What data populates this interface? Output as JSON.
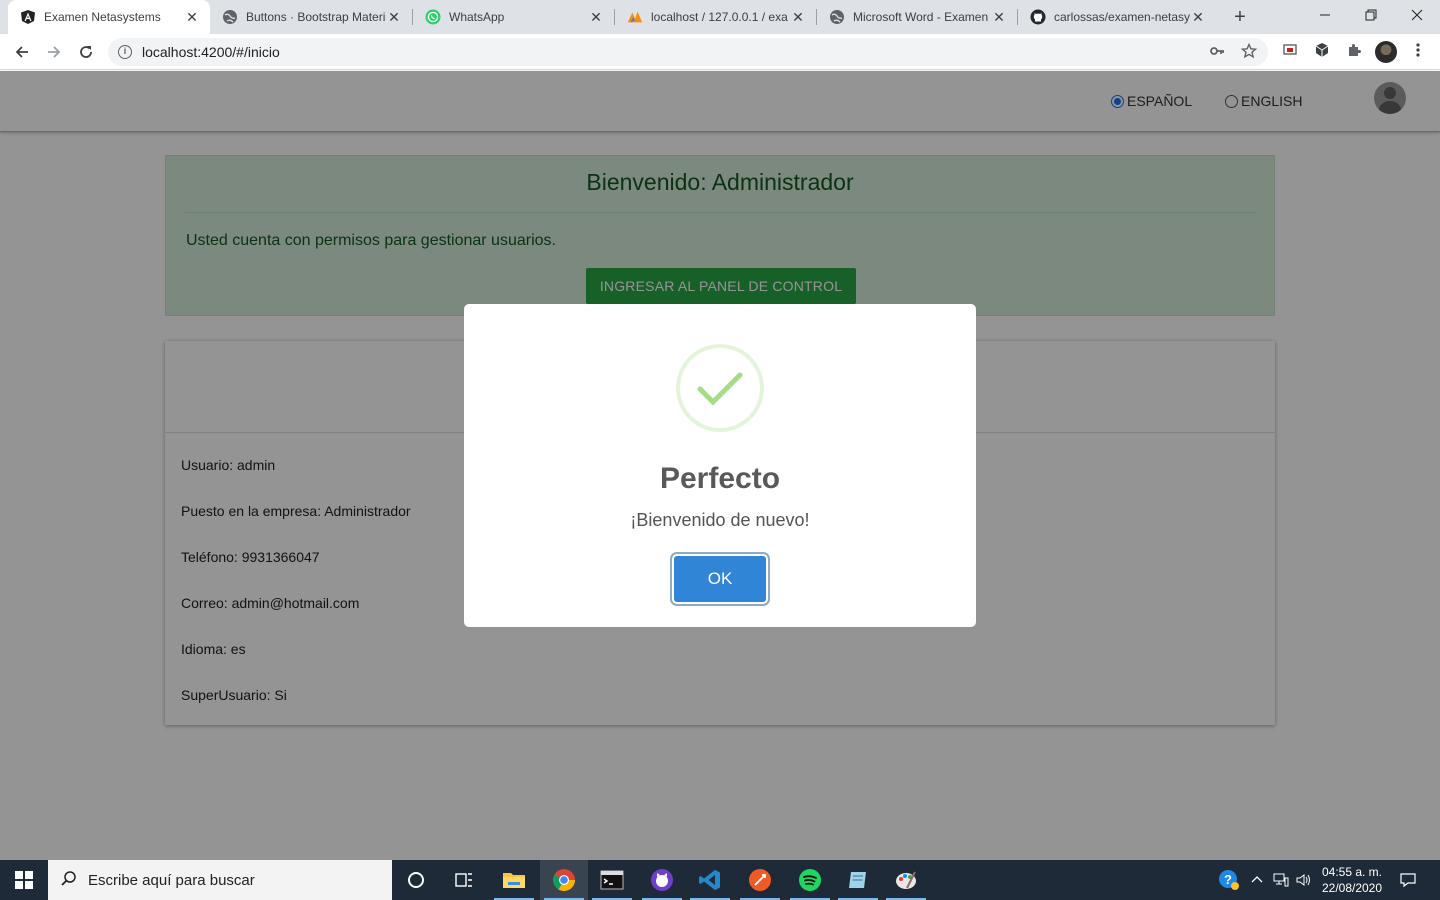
{
  "browser": {
    "tabs": [
      {
        "title": "Examen Netasystems",
        "icon": "angular-icon",
        "active": true
      },
      {
        "title": "Buttons · Bootstrap Material",
        "icon": "globe-icon",
        "active": false
      },
      {
        "title": "WhatsApp",
        "icon": "whatsapp-icon",
        "active": false
      },
      {
        "title": "localhost / 127.0.0.1 / exa",
        "icon": "phpmyadmin-icon",
        "active": false
      },
      {
        "title": "Microsoft Word - Examen",
        "icon": "globe-icon",
        "active": false
      },
      {
        "title": "carlossas/examen-netasys",
        "icon": "github-icon",
        "active": false
      }
    ],
    "url": "localhost:4200/#/inicio"
  },
  "app": {
    "languages": [
      {
        "label": "ESPAÑOL",
        "checked": true
      },
      {
        "label": "ENGLISH",
        "checked": false
      }
    ],
    "welcome": {
      "title": "Bienvenido: Administrador",
      "message": "Usted cuenta con permisos para gestionar usuarios.",
      "button": "INGRESAR AL PANEL DE CONTROL"
    },
    "profile": {
      "fields": [
        "Usuario: admin",
        "Puesto en la empresa: Administrador",
        "Teléfono: 9931366047",
        "Correo: admin@hotmail.com",
        "Idioma: es",
        "SuperUsuario: Si"
      ]
    }
  },
  "modal": {
    "icon": "success-check-icon",
    "title": "Perfecto",
    "message": "¡Bienvenido de nuevo!",
    "ok": "OK"
  },
  "taskbar": {
    "search_placeholder": "Escribe aquí para buscar",
    "time": "04:55 a. m.",
    "date": "22/08/2020"
  },
  "colors": {
    "success_green": "#28a745",
    "alert_bg": "#d4edda",
    "ok_blue": "#3085d6",
    "check_green": "#a5dc86"
  }
}
